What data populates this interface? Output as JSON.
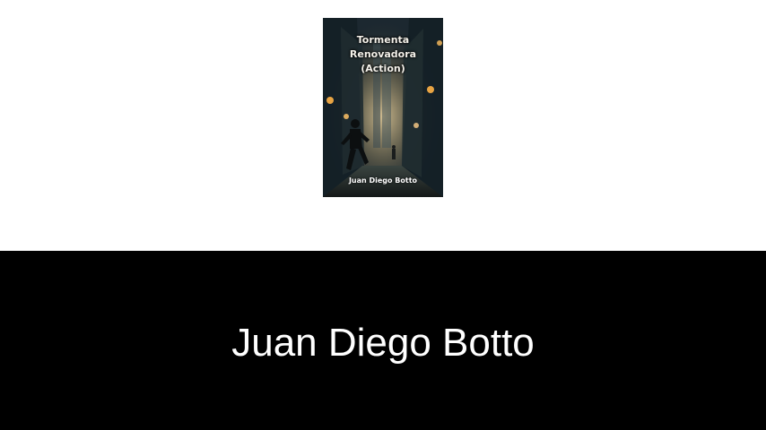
{
  "book": {
    "cover_title_lines": [
      "Tormenta",
      "Renovadora",
      "(Action)"
    ],
    "cover_author": "Juan Diego Botto"
  },
  "banner": {
    "author_name": "Juan Diego Botto",
    "background_color": "#000000",
    "text_color": "#ffffff"
  },
  "page": {
    "background_color": "#ffffff"
  }
}
